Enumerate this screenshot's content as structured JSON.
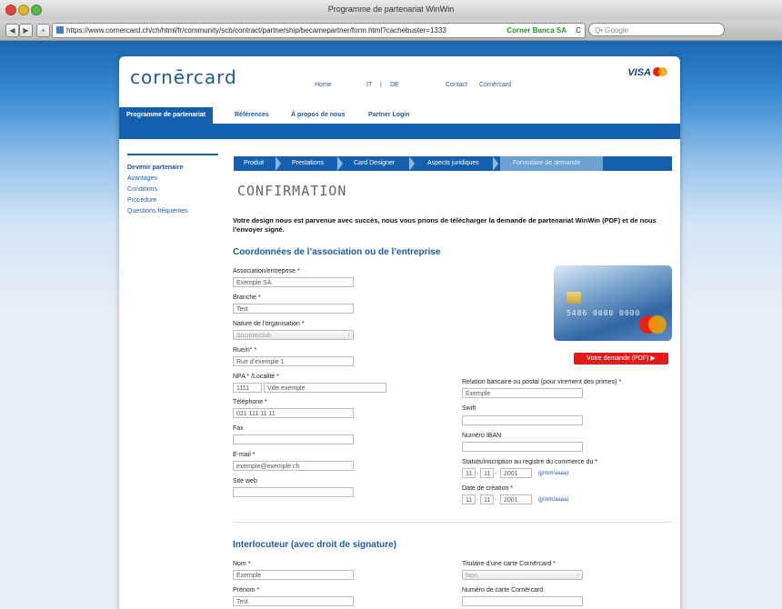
{
  "browser": {
    "window_title": "Programme de partenariat WinWin",
    "url": "https://www.cornercard.ch/ch/html/fr/community/scb/contract/partnership/becamepartner/form.html?cachebuster=1333",
    "site_identity": "Corner Banca SA",
    "reload": "C",
    "search_placeholder": "Q• Google",
    "back": "◀",
    "forward": "▶",
    "add": "+"
  },
  "header": {
    "logo": "cornērcard",
    "card_brand": "VISA",
    "top_links": {
      "home": "Home",
      "it": "IT",
      "sep": "|",
      "de": "DE",
      "contact": "Contact",
      "cornercard": "Cornērcard"
    }
  },
  "main_nav": [
    "Programme de partenariat",
    "Références",
    "À propos de nous",
    "Partner Login"
  ],
  "left_nav": [
    "Devenir partenaire",
    "Avantages",
    "Conditions",
    "Procédure",
    "Questions fréquentes"
  ],
  "steps": [
    "Produit",
    "Prestations",
    "Card Designer",
    "Aspects juridiques",
    "Formulaire de demande"
  ],
  "page_title": "CONFIRMATION",
  "intro": "Votre design nous est parvenue avec succès, nous vous prions de télécharger la demande de partenariat WinWin (PDF) et de nous l’envoyer signé.",
  "section1_title": "Coordonnées de l’association ou de l’entreprise",
  "form": {
    "association_label": "Association/entreprise *",
    "association_value": "Exemple SA",
    "branche_label": "Branche *",
    "branche_value": "Test",
    "nature_label": "Nature de l’organisation *",
    "nature_value": "Société/club",
    "rue_label": "Rue/n° *",
    "rue_value": "Rue d’exemple 1",
    "npa_label": "NPA * /Localité *",
    "npa_value": "1111",
    "localite_value": "Ville exemple",
    "tel_label": "Téléphone *",
    "tel_value": "021 111 11 11",
    "fax_label": "Fax",
    "email_label": "E-mail *",
    "email_value": "exemple@exemple.ch",
    "web_label": "Site web",
    "relation_label": "Relation bancaire ou postal (pour virement des primes) *",
    "relation_value": "Exemple",
    "swift_label": "Swift",
    "iban_label": "Numéro IBAN",
    "statuts_label": "Statuts/inscription au registre du commerce du *",
    "statuts_d": "11",
    "statuts_m": "11",
    "statuts_y": "2001",
    "date_format": "(jj/mm/aaaa)",
    "creation_label": "Date de création *",
    "creation_d": "11",
    "creation_m": "11",
    "creation_y": "2001",
    "dot": "."
  },
  "card_number": "5486 0000 0000",
  "download_button": "Votre demande (PDF)",
  "download_arrow": "▶",
  "section2_title": "Interlocuteur (avec droit de signature)",
  "form2": {
    "nom_label": "Nom *",
    "nom_value": "Exemple",
    "prenom_label": "Prénom *",
    "prenom_value": "Test",
    "titulaire_label": "Titulaire d’une carte Cornērcard *",
    "titulaire_value": "Non",
    "numero_label": "Numéro de carte Cornērcard"
  },
  "colors": {
    "brand_blue": "#1560ae",
    "accent_red": "#e21a1a"
  }
}
